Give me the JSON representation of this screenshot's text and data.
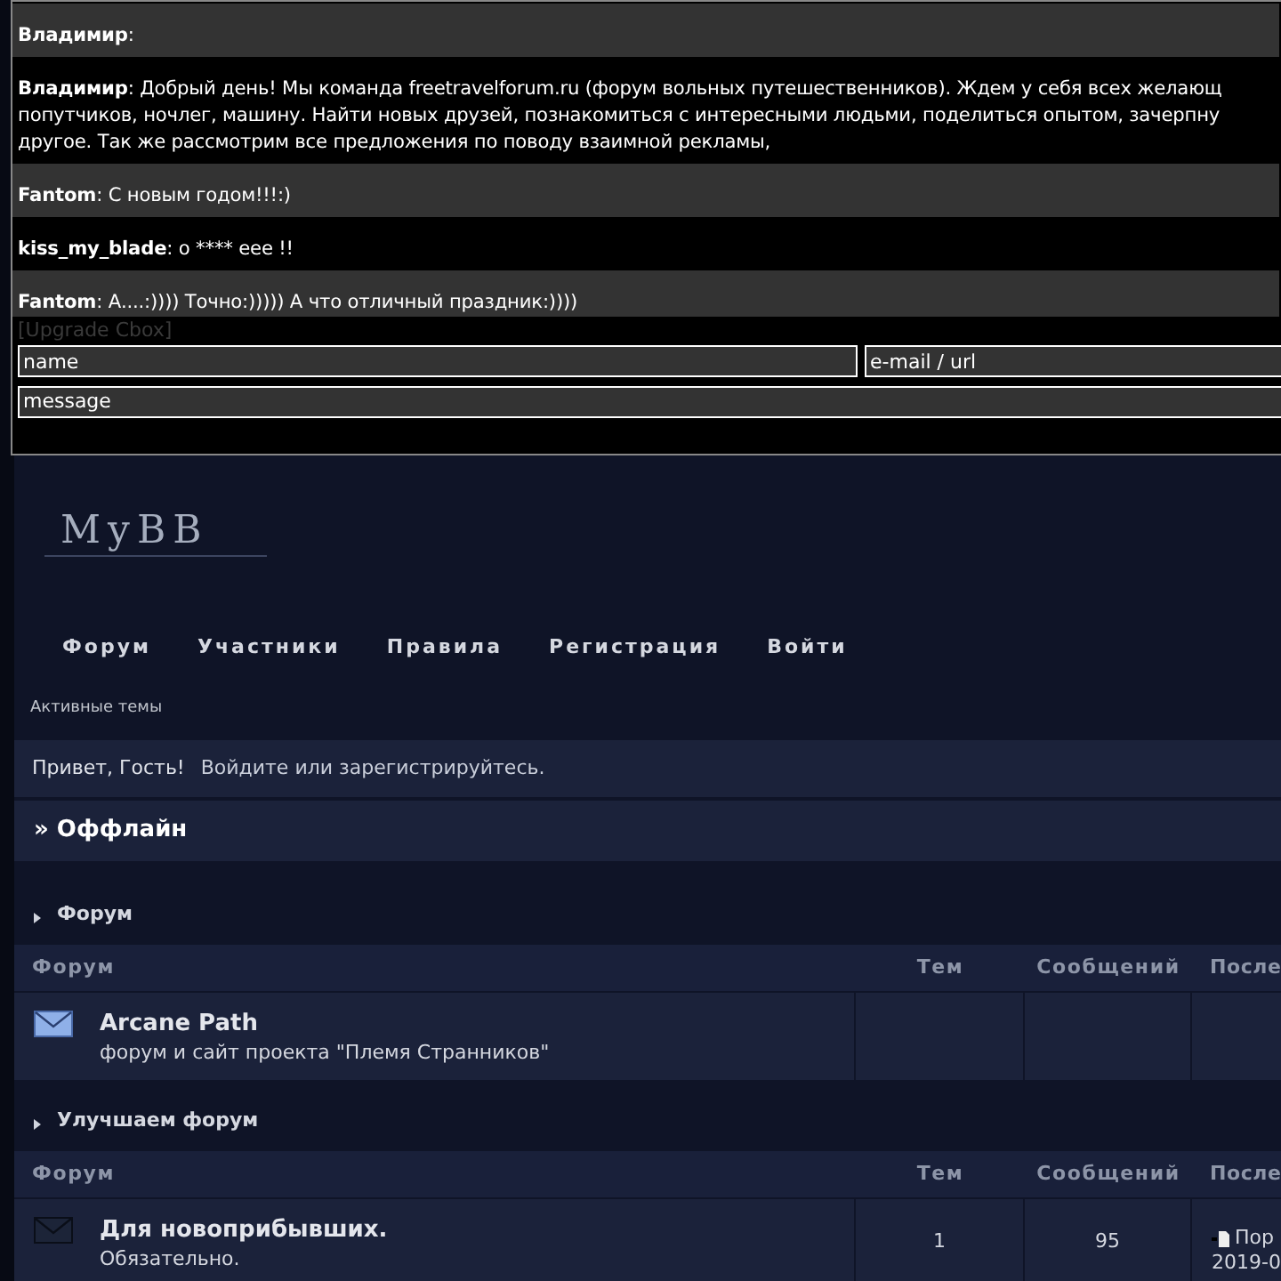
{
  "chat": {
    "messages": [
      {
        "author": "Владимир",
        "lines": [
          ":"
        ]
      },
      {
        "author": "Владимир",
        "lines": [
          ": Добрый день! Мы команда freetravelforum.ru (форум вольных путешественников). Ждем у себя всех желающ",
          "попутчиков, ночлег, машину. Найти новых друзей, познакомиться с интересными людьми, поделиться опытом, зачерпну",
          "другое. Так же рассмотрим все предложения по поводу взаимной рекламы,"
        ]
      },
      {
        "author": "Fantom",
        "lines": [
          ": С новым годом!!!:)"
        ]
      },
      {
        "author": "kiss_my_blade",
        "lines": [
          ": о **** eee !!"
        ]
      },
      {
        "author": "Fantom",
        "lines": [
          ": А....:)))) Точно:))))) А что отличный праздник:))))"
        ]
      }
    ],
    "upgrade_link": "[Upgrade Cbox]",
    "name_field": {
      "placeholder": "name"
    },
    "email_field": {
      "placeholder": "e-mail / url"
    },
    "message_field": {
      "placeholder": "message"
    }
  },
  "logo": "MyBB",
  "nav": [
    "Форум",
    "Участники",
    "Правила",
    "Регистрация",
    "Войти"
  ],
  "active_topics": "Активные темы",
  "welcome": {
    "greeting": "Привет, Гость!",
    "prompt": "Войдите или зарегистрируйтесь."
  },
  "offline_title": "» Оффлайн",
  "categories": [
    {
      "title": "Форум",
      "columns": [
        "Форум",
        "Тем",
        "Сообщений",
        "После"
      ],
      "forums": [
        {
          "name": "Arcane Path",
          "description": "форум и сайт проекта \"Племя Странников\"",
          "unread": true
        }
      ]
    },
    {
      "title": "Улучшаем форум",
      "columns": [
        "Форум",
        "Тем",
        "Сообщений",
        "После"
      ],
      "forums": [
        {
          "name": "Для новоприбывших.",
          "description": "Обязательно.",
          "unread": false,
          "topics": "1",
          "posts": "95",
          "last_post": [
            "Пор",
            "2019-0"
          ]
        }
      ]
    }
  ]
}
